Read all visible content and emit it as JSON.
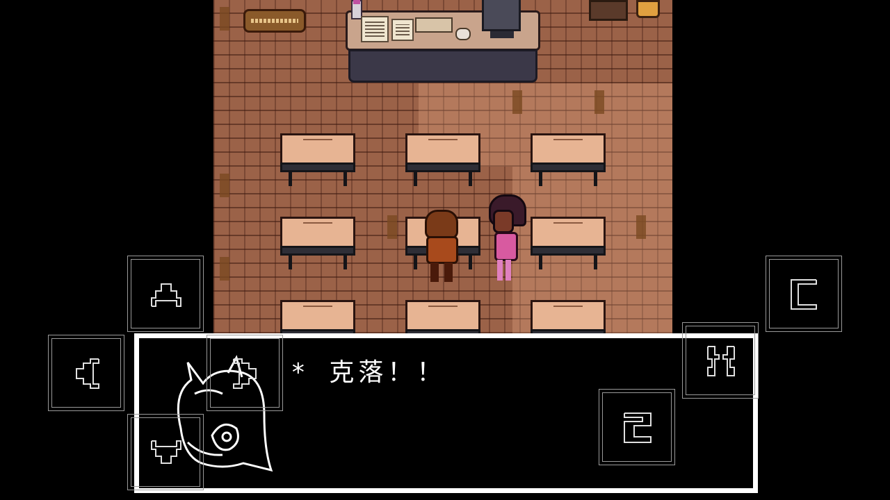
{
  "dialogue": {
    "bullet": "*",
    "text": "克落！！",
    "speaker_portrait": "susie-portrait"
  },
  "touch_controls": [
    {
      "name": "dpad-up-button",
      "icon": "up-arrow-icon"
    },
    {
      "name": "dpad-left-button",
      "icon": "left-arrow-icon"
    },
    {
      "name": "dpad-right-button",
      "icon": "right-arrow-icon"
    },
    {
      "name": "dpad-down-button",
      "icon": "down-arrow-icon"
    },
    {
      "name": "c-button",
      "icon": "c-letter-icon"
    },
    {
      "name": "x-button",
      "icon": "x-letter-icon"
    },
    {
      "name": "z-button",
      "icon": "z-letter-icon"
    }
  ],
  "colors": {
    "floor": "#9b6248",
    "dialogue_border": "#ffffff",
    "desk_top": "#e7b493"
  }
}
